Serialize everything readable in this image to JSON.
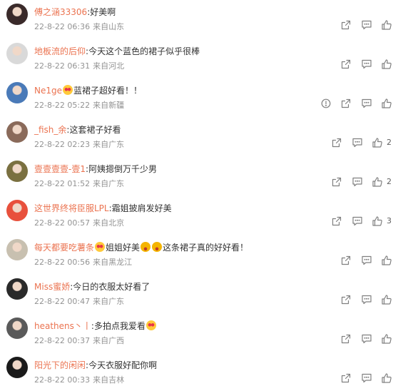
{
  "colors": {
    "username": "#eb7350",
    "text": "#333333",
    "meta": "#939393",
    "icon": "#808080"
  },
  "comments": [
    {
      "user": "傅之涵33306",
      "sep": ":",
      "body_parts": [
        "好美啊"
      ],
      "emoji": [],
      "date": "22-8-22 06:36",
      "place": "来自山东",
      "likes": "",
      "report": false,
      "avatar": "#3a2a2a"
    },
    {
      "user": "地板流的后仰",
      "sep": ":",
      "body_parts": [
        "今天这个蓝色的裙子似乎很棒"
      ],
      "emoji": [],
      "date": "22-8-22 06:31",
      "place": "来自河北",
      "likes": "",
      "report": false,
      "avatar": "#d9d9d9"
    },
    {
      "user": "Ne1ge",
      "sep": "",
      "body_parts": [
        "",
        "蓝裙子超好看！！"
      ],
      "emoji": [
        "heart-eyes"
      ],
      "date": "22-8-22 05:22",
      "place": "来自新疆",
      "likes": "",
      "report": true,
      "avatar": "#4a7ab8"
    },
    {
      "user": "_fish_余",
      "sep": ":",
      "body_parts": [
        "这套裙子好看"
      ],
      "emoji": [],
      "date": "22-8-22 02:23",
      "place": "来自广东",
      "likes": "2",
      "report": false,
      "avatar": "#8a6a5a"
    },
    {
      "user": "壹壹壹壹-壹1",
      "sep": ":",
      "body_parts": [
        "阿姨摁倒万千少男"
      ],
      "emoji": [],
      "date": "22-8-22 01:52",
      "place": "来自广东",
      "likes": "2",
      "report": false,
      "avatar": "#7a7040"
    },
    {
      "user": "这世界终将臣服LPL",
      "sep": ":",
      "body_parts": [
        "霜姐披肩发好美"
      ],
      "emoji": [],
      "date": "22-8-22 00:57",
      "place": "来自北京",
      "likes": "3",
      "report": false,
      "avatar": "#e8503c"
    },
    {
      "user": "每天都要吃薯条",
      "sep": "",
      "body_parts": [
        "",
        "姐姐好美",
        "",
        "这条裙子真的好好看！"
      ],
      "emoji": [
        "heart-eyes",
        "cheer",
        "cheer"
      ],
      "date": "22-8-22 00:56",
      "place": "来自黑龙江",
      "likes": "",
      "report": false,
      "avatar": "#c8c0b0"
    },
    {
      "user": "Miss蜜娇",
      "sep": ":",
      "body_parts": [
        "今日的衣服太好看了"
      ],
      "emoji": [],
      "date": "22-8-22 00:47",
      "place": "来自广东",
      "likes": "",
      "report": false,
      "avatar": "#2a2a2a"
    },
    {
      "user": "heathens丶丨",
      "sep": ":",
      "body_parts": [
        "多拍点我爱看"
      ],
      "emoji": [
        "heart-eyes"
      ],
      "date": "22-8-22 00:37",
      "place": "来自广西",
      "likes": "",
      "report": false,
      "avatar": "#5a5a5a"
    },
    {
      "user": "阳光下的闲闲",
      "sep": ":",
      "body_parts": [
        "今天衣服好配你啊"
      ],
      "emoji": [],
      "date": "22-8-22 00:33",
      "place": "来自吉林",
      "likes": "",
      "report": false,
      "avatar": "#1a1a1a"
    }
  ],
  "icons": {
    "forward": "forward-icon",
    "comment": "comment-icon",
    "like": "thumbs-up-icon",
    "report": "report-icon"
  }
}
